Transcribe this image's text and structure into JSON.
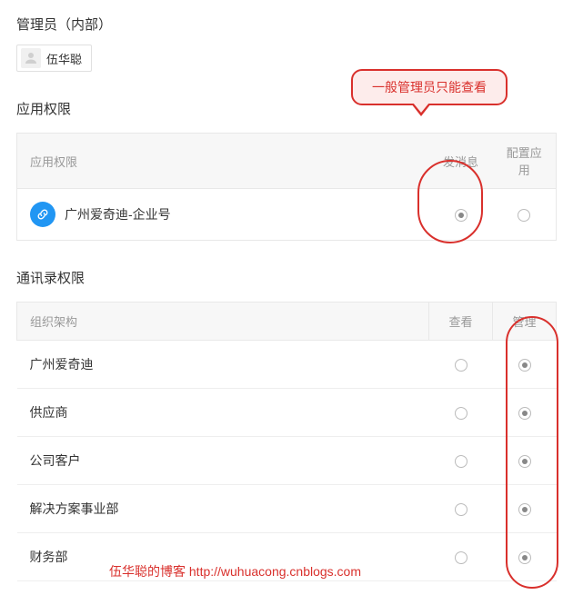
{
  "header": {
    "title": "管理员（内部）",
    "admin_name": "伍华聪"
  },
  "callout": {
    "text": "一般管理员只能查看"
  },
  "app_permissions": {
    "section_title": "应用权限",
    "col_name": "应用权限",
    "col_send": "发消息",
    "col_config": "配置应用",
    "rows": [
      {
        "name": "广州爱奇迪-企业号",
        "send": true,
        "config": false
      }
    ]
  },
  "contact_permissions": {
    "section_title": "通讯录权限",
    "col_org": "组织架构",
    "col_view": "查看",
    "col_manage": "管理",
    "rows": [
      {
        "name": "广州爱奇迪",
        "view": false,
        "manage": true
      },
      {
        "name": "供应商",
        "view": false,
        "manage": true
      },
      {
        "name": "公司客户",
        "view": false,
        "manage": true
      },
      {
        "name": "解决方案事业部",
        "view": false,
        "manage": true
      },
      {
        "name": "财务部",
        "view": false,
        "manage": true
      }
    ]
  },
  "watermark": {
    "text": "伍华聪的博客 http://wuhuacong.cnblogs.com"
  }
}
